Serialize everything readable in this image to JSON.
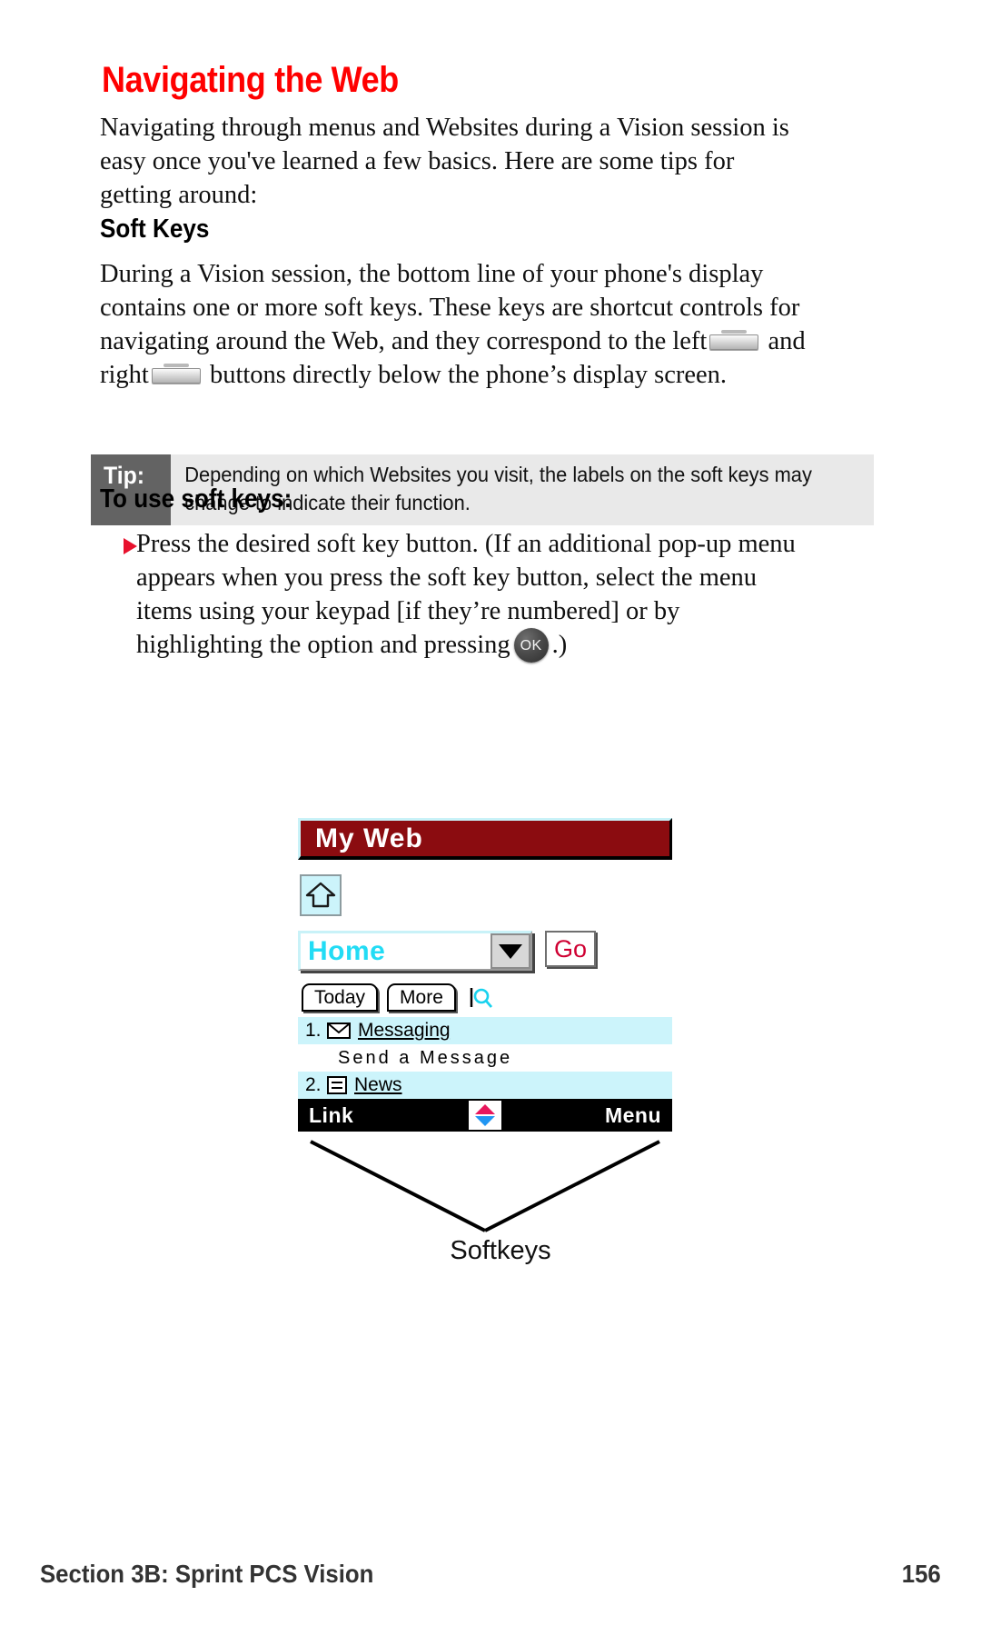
{
  "document": {
    "title": "Navigating the Web",
    "title_color": "#ff0000",
    "intro_paragraph": "Navigating through menus and Websites during a Vision session is easy once you've learned a few basics. Here are some tips for getting around:",
    "section_heading": "Soft Keys",
    "body_paragraph_part1": "During a Vision session, the bottom line of your phone's display contains one or more soft keys. These keys are shortcut controls for navigating around the Web, and they correspond to the left",
    "body_paragraph_part2": "and right",
    "body_paragraph_part3": "buttons directly below the phone’s display screen.",
    "tip": {
      "label": "Tip:",
      "text": "Depending on which Websites you visit, the labels on the soft keys may change to indicate their function.",
      "label_bg": "#636363",
      "body_bg": "#e9e9e9"
    },
    "procedure_heading": "To use soft keys:",
    "bullet": {
      "marker_color": "#e8112d",
      "text_part1": "Press the desired soft key button. (If an additional pop-up menu appears when you press the soft key button, select the menu items using your keypad [if they’re numbered] or by highlighting the option and pressing",
      "text_part2": ".)",
      "ok_button_label": "OK"
    }
  },
  "phone_mock": {
    "title_bar": {
      "text": "My Web",
      "bg": "#8b0c10",
      "text_color": "#ffffff"
    },
    "home_icon": "home-icon",
    "address_bar": {
      "value": "Home",
      "value_color": "#22dcf5",
      "dropdown_icon": "chevron-down-icon",
      "go_label": "Go",
      "go_color": "#cf0032"
    },
    "tabs": [
      {
        "label": "Today"
      },
      {
        "label": "More"
      }
    ],
    "search_icon": "magnifier-icon",
    "menu_items": [
      {
        "number": "1.",
        "icon": "envelope-icon",
        "label": "Messaging",
        "highlighted": true
      },
      {
        "number": "2.",
        "icon": "list-icon",
        "label": "News",
        "highlighted": true
      }
    ],
    "menu_subtext": "Send a Message",
    "soft_bar": {
      "left_label": "Link",
      "right_label": "Menu",
      "bg": "#000000",
      "scroll_up_color": "#e8175d",
      "scroll_down_color": "#2196f3"
    },
    "callout_label": "Softkeys"
  },
  "footer": {
    "left": "Section 3B: Sprint PCS Vision",
    "right": "156"
  }
}
